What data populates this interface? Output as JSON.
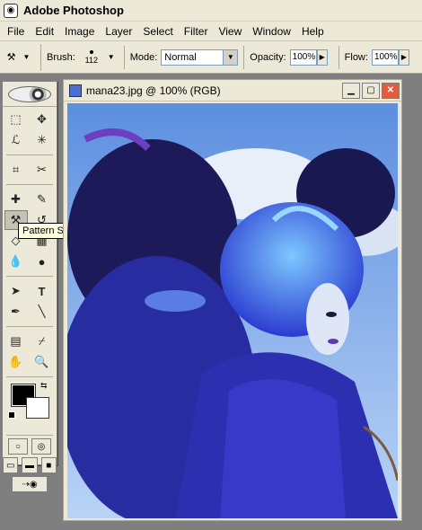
{
  "titlebar": {
    "title": "Adobe Photoshop"
  },
  "menu": [
    "File",
    "Edit",
    "Image",
    "Layer",
    "Select",
    "Filter",
    "View",
    "Window",
    "Help"
  ],
  "options": {
    "brush_label": "Brush:",
    "brush_size": "112",
    "mode_label": "Mode:",
    "mode_value": "Normal",
    "opacity_label": "Opacity:",
    "opacity_value": "100%",
    "flow_label": "Flow:",
    "flow_value": "100%"
  },
  "tooltip": {
    "text": "Pattern Stamp Tool (S)"
  },
  "document": {
    "title": "mana23.jpg @ 100% (RGB)"
  },
  "colors": {
    "accent": "#0a246a",
    "close": "#e25d3d",
    "tooltip_bg": "#ffffe1",
    "photo_main": "#2c2fb0"
  }
}
